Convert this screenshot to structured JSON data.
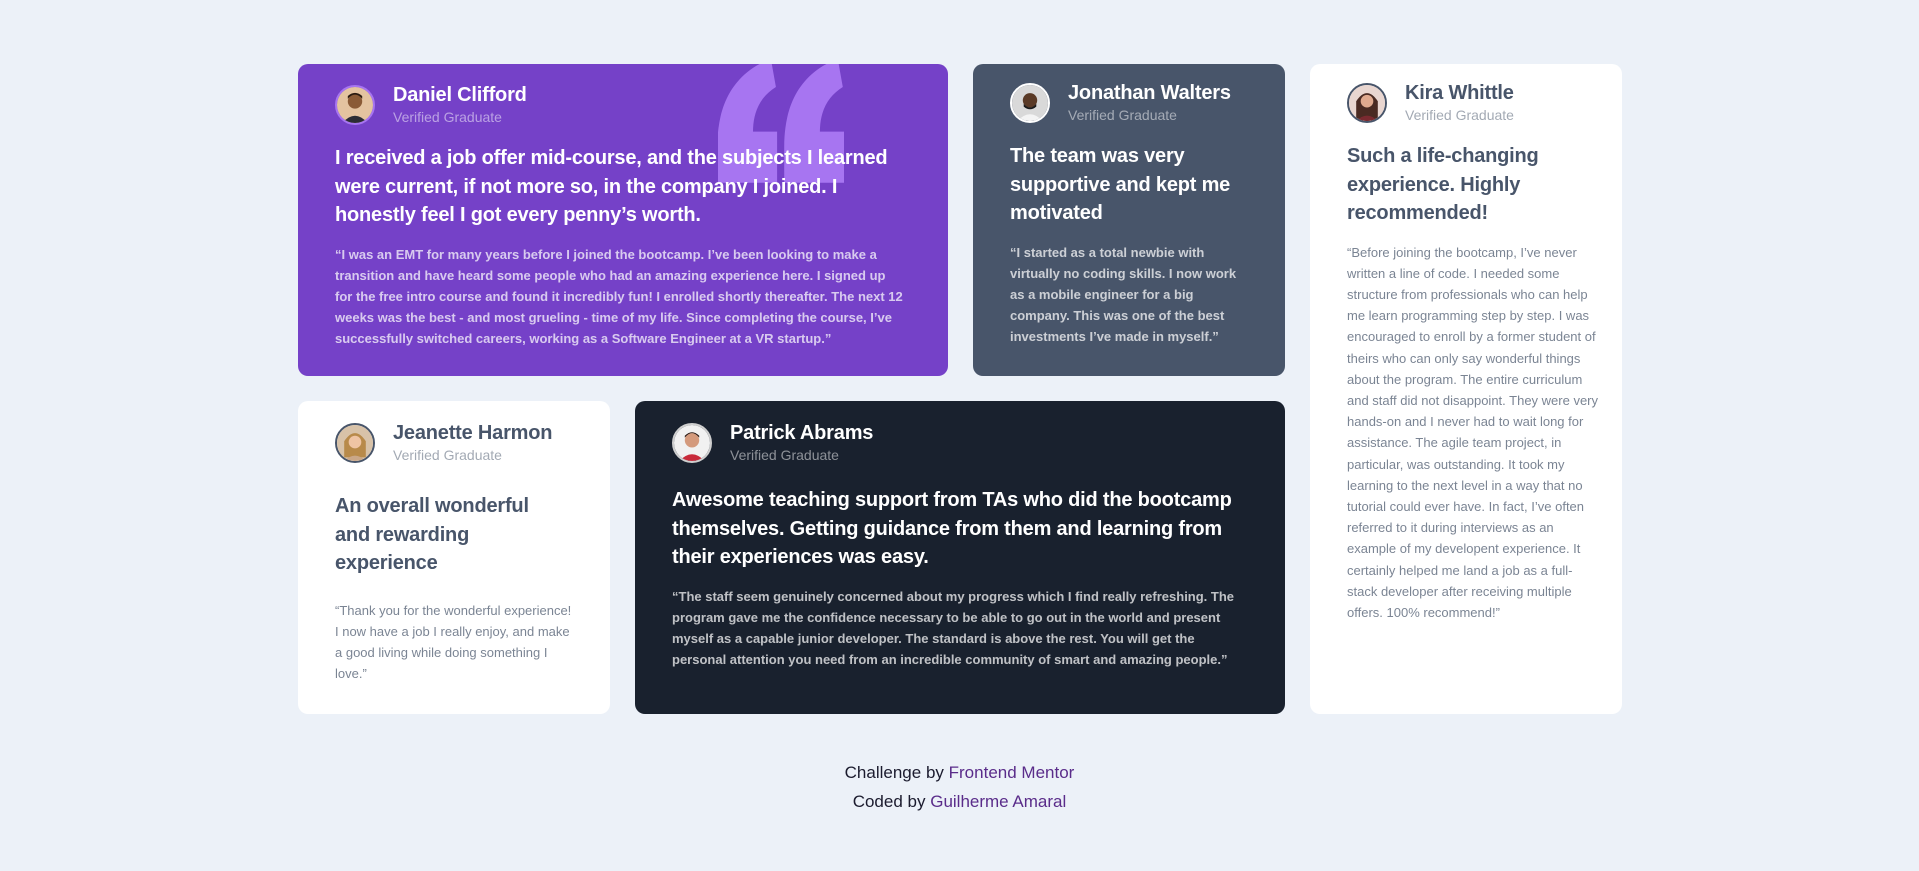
{
  "testimonials": [
    {
      "name": "Daniel Clifford",
      "role": "Verified Graduate",
      "headline": "I received a job offer mid-course, and the subjects I learned were current, if not more so, in the company I joined. I honestly feel I got every penny’s worth.",
      "quote": "“I was an EMT for many years before I joined the bootcamp. I’ve been looking to make a transition and have heard some people who had an amazing experience here. I signed up for the free intro course and found it incredibly fun! I enrolled shortly thereafter. The next 12 weeks was the best - and most grueling - time of my life. Since completing the course, I’ve successfully switched careers, working as a Software Engineer at a VR startup.”",
      "icon": "avatar-photo"
    },
    {
      "name": "Jonathan Walters",
      "role": "Verified Graduate",
      "headline": "The team was very supportive and kept me motivated",
      "quote": "“I started as a total newbie with virtually no coding skills. I now work as a mobile engineer for a big company. This was one of the best investments I’ve made in myself.”",
      "icon": "avatar-photo"
    },
    {
      "name": "Kira Whittle",
      "role": "Verified Graduate",
      "headline": "Such a life-changing experience. Highly recommended!",
      "quote": "“Before joining the bootcamp, I’ve never written a line of code. I needed some structure from professionals who can help me learn programming step by step. I was encouraged to enroll by a former student of theirs who can only say wonderful things about the program. The entire curriculum and staff did not disappoint. They were very hands-on and I never had to wait long for assistance. The agile team project, in particular, was outstanding. It took my learning to the next level in a way that no tutorial could ever have. In fact, I’ve often referred to it during interviews as an example of my developent experience. It certainly helped me land a job as a full-stack developer after receiving multiple offers. 100% recommend!”",
      "icon": "avatar-photo"
    },
    {
      "name": "Jeanette Harmon",
      "role": "Verified Graduate",
      "headline": "An overall wonderful and rewarding experience",
      "quote": "“Thank you for the wonderful experience! I now have a job I really enjoy, and make a good living while doing something I love.”",
      "icon": "avatar-photo"
    },
    {
      "name": "Patrick Abrams",
      "role": "Verified Graduate",
      "headline": "Awesome teaching support from TAs who did the bootcamp themselves. Getting guidance from them and learning from their experiences was easy.",
      "quote": "“The staff seem genuinely concerned about my progress which I find really refreshing. The program gave me the confidence necessary to be able to go out in the world and present myself as a capable junior developer. The standard is above the rest. You will get the personal attention you need from an incredible community of smart and amazing people.”",
      "icon": "avatar-photo"
    }
  ],
  "decoration": {
    "quote_icon": "quotation-mark-icon"
  },
  "footer": {
    "challenge_prefix": "Challenge by",
    "challenge_link": "Frontend Mentor",
    "coded_prefix": "Coded by",
    "coded_link": "Guilherme Amaral"
  },
  "colors": {
    "background": "#ecf1f8",
    "purple": "#7541c8",
    "gray_blue": "#48556a",
    "dark": "#19212e",
    "white": "#ffffff",
    "link": "#5a2c8a"
  }
}
